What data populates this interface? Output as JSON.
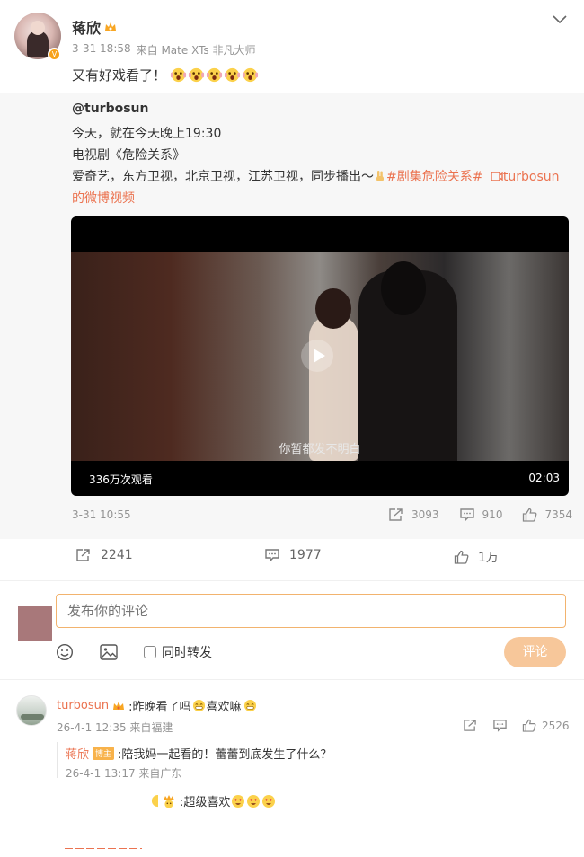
{
  "post": {
    "author": "蒋欣",
    "time": "3-31 18:58",
    "source": "来自 Mate XTs 非凡大师",
    "text": "又有好戏看了！",
    "emoji_count": 5
  },
  "repost": {
    "author": "@turbosun",
    "lines": [
      "今天，就在今天晚上19:30",
      "电视剧《危险关系》"
    ],
    "line3_text": "爱奇艺，东方卫视，北京卫视，江苏卫视，同步播出～",
    "hashtag": "#剧集危险关系#",
    "video_link": "turbosun",
    "video_link_suffix": "的微博视频",
    "video": {
      "subtitle": "你暂都发不明白",
      "views": "336万次观看",
      "duration": "02:03"
    },
    "time": "3-31 10:55",
    "forwards": "3093",
    "comments": "910",
    "likes": "7354"
  },
  "actions": {
    "forwards": "2241",
    "comments": "1977",
    "likes": "1万"
  },
  "composer": {
    "placeholder": "发布你的评论",
    "also_repost": "同时转发",
    "submit": "评论"
  },
  "comments": [
    {
      "user": "turbosun",
      "text": ":昨晚看了吗",
      "text2": "喜欢嘛",
      "time": "26-4-1 12:35 来自福建",
      "likes": "2526",
      "reply": {
        "user": "蒋欣",
        "badge": "博主",
        "text": ":陪我妈一起看的！蕾蕾到底发生了什么？",
        "time": "26-4-1 13:17 来自广东"
      }
    }
  ],
  "partial_comment": {
    "text": ":超级喜欢"
  },
  "colors": {
    "accent": "#eb7350",
    "submit_disabled": "#f7c79a",
    "repost_bg": "#f7f7f7",
    "gray": "#939393"
  }
}
